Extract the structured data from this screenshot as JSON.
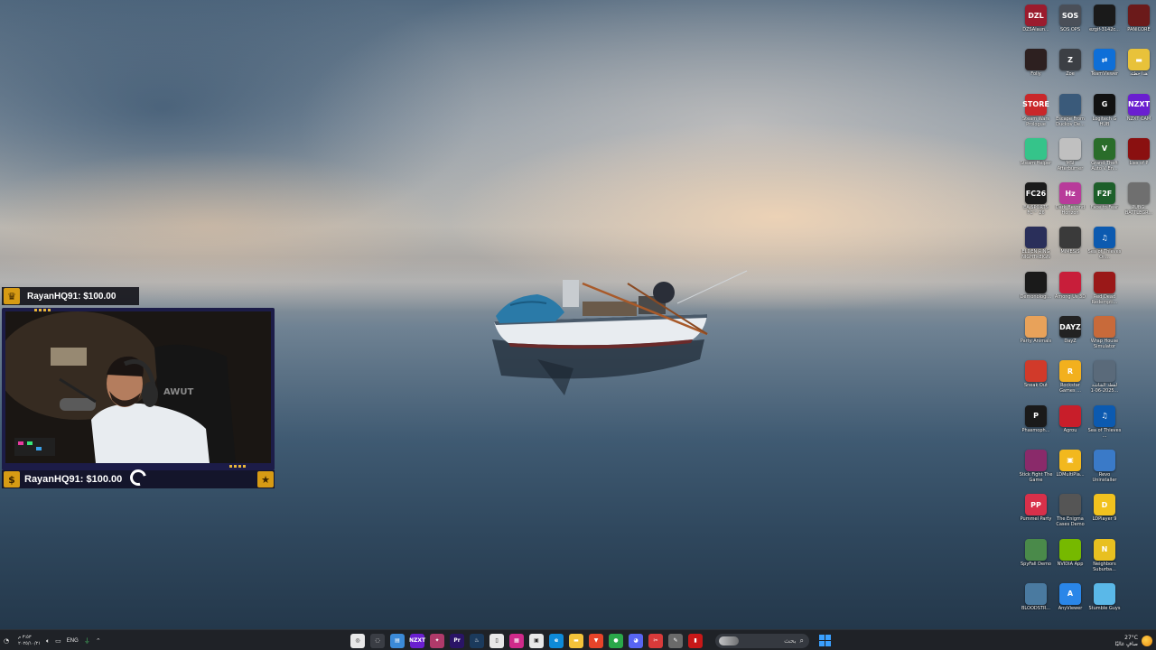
{
  "overlay": {
    "top_alert": "RayanHQ91: $100.00",
    "bottom_alert": "RayanHQ91: $100.00",
    "chair_brand": "AWUT"
  },
  "desktop_icons": [
    {
      "label": "DZSAlaun...",
      "tile": "DZL",
      "color": "#9b1c2e"
    },
    {
      "label": "SOS OPS",
      "tile": "SOS",
      "color": "#4a4f58"
    },
    {
      "label": "ezgif-3142c...",
      "tile": "",
      "color": "#1a1a1a"
    },
    {
      "label": "PANICORE",
      "tile": "",
      "color": "#6b1a1a"
    },
    {
      "label": "Folly",
      "tile": "",
      "color": "#2d2020"
    },
    {
      "label": "Zoe",
      "tile": "Z",
      "color": "#3c3f44"
    },
    {
      "label": "TeamViewer",
      "tile": "⇄",
      "color": "#0e6fd8"
    },
    {
      "label": "هذا خطئه",
      "tile": "▬",
      "color": "#e8c23a"
    },
    {
      "label": "Steam Wars Prologue",
      "tile": "STORE",
      "color": "#c9272a"
    },
    {
      "label": "Escape From Duckov De...",
      "tile": "",
      "color": "#3a5a7a"
    },
    {
      "label": "Logitech G HUB",
      "tile": "G",
      "color": "#111111"
    },
    {
      "label": "NZXT CAM",
      "tile": "NZXT",
      "color": "#6a1fd0"
    },
    {
      "label": "Steam Helper",
      "tile": "",
      "color": "#35c48a"
    },
    {
      "label": "MSI Afterburner",
      "tile": "",
      "color": "#c0c0c0"
    },
    {
      "label": "Grand Theft Auto V En...",
      "tile": "V",
      "color": "#2a6d2a"
    },
    {
      "label": "Lies of P",
      "tile": "",
      "color": "#8a1010"
    },
    {
      "label": "EA SPORTS FC™ 26",
      "tile": "FC26",
      "color": "#1b1b1b"
    },
    {
      "label": "Dark Beyond Horizon",
      "tile": "Hz",
      "color": "#b83b9a"
    },
    {
      "label": "Face to Fear",
      "tile": "F2F",
      "color": "#1d5f2a"
    },
    {
      "label": "PUBG: BATTLEGR...",
      "tile": "",
      "color": "#6f6f6f"
    },
    {
      "label": "ELDEN RING NIGHTREIGN",
      "tile": "",
      "color": "#2a2f5a"
    },
    {
      "label": "MIMESIS",
      "tile": "",
      "color": "#3a3a3a"
    },
    {
      "label": "Sea of Thieves On...",
      "tile": "♫",
      "color": "#0c5ab0"
    },
    {
      "label": "",
      "tile": "",
      "color": "transparent"
    },
    {
      "label": "Demonologi...",
      "tile": "",
      "color": "#1a1a1a"
    },
    {
      "label": "Among Us 3D",
      "tile": "",
      "color": "#c81e3a"
    },
    {
      "label": "Red Dead Redempti...",
      "tile": "",
      "color": "#9a1818"
    },
    {
      "label": "",
      "tile": "",
      "color": "transparent"
    },
    {
      "label": "Party Animals",
      "tile": "",
      "color": "#e8a25a"
    },
    {
      "label": "DayZ",
      "tile": "DAYZ",
      "color": "#222222"
    },
    {
      "label": "Wrap House Simulator",
      "tile": "",
      "color": "#c86a3a"
    },
    {
      "label": "",
      "tile": "",
      "color": "transparent"
    },
    {
      "label": "Sneak Out",
      "tile": "",
      "color": "#d13a2a"
    },
    {
      "label": "Rockstar Games ...",
      "tile": "R",
      "color": "#f2b01e"
    },
    {
      "label": "لقطة الشاشة 2025-06-1...",
      "tile": "",
      "color": "#5a6a7a"
    },
    {
      "label": "",
      "tile": "",
      "color": "transparent"
    },
    {
      "label": "Phasmoph...",
      "tile": "P",
      "color": "#1a1a1a"
    },
    {
      "label": "Agrou",
      "tile": "",
      "color": "#c81e2a"
    },
    {
      "label": "Sea of Thieves ...",
      "tile": "♫",
      "color": "#0c5ab0"
    },
    {
      "label": "",
      "tile": "",
      "color": "transparent"
    },
    {
      "label": "Stick Fight The Game",
      "tile": "",
      "color": "#8a2a6a"
    },
    {
      "label": "LDMultiPla...",
      "tile": "▣",
      "color": "#f2b81e"
    },
    {
      "label": "Revo Uninstaller",
      "tile": "",
      "color": "#3a7ac8"
    },
    {
      "label": "",
      "tile": "",
      "color": "transparent"
    },
    {
      "label": "Pummel Party",
      "tile": "PP",
      "color": "#d8304a"
    },
    {
      "label": "The Enigma Cases Demo",
      "tile": "",
      "color": "#555555"
    },
    {
      "label": "LDPlayer 9",
      "tile": "D",
      "color": "#f2c21e"
    },
    {
      "label": "",
      "tile": "",
      "color": "transparent"
    },
    {
      "label": "SpyFall Demo",
      "tile": "",
      "color": "#4a8a4a"
    },
    {
      "label": "NVIDIA App",
      "tile": "",
      "color": "#76b900"
    },
    {
      "label": "Neighbors Suburba...",
      "tile": "N",
      "color": "#e8c020"
    },
    {
      "label": "",
      "tile": "",
      "color": "transparent"
    },
    {
      "label": "BLOODSTR...",
      "tile": "",
      "color": "#4a7aa0"
    },
    {
      "label": "AnyViewer",
      "tile": "A",
      "color": "#2a86e8"
    },
    {
      "label": "Stumble Guys",
      "tile": "",
      "color": "#5ab8e8"
    }
  ],
  "taskbar": {
    "time": "٣:٥٣ م",
    "date": "٢٠٢٥/١٠/٢١",
    "language": "ENG",
    "search_placeholder": "بحث",
    "weather_temp": "27°C",
    "weather_desc": "صافٍ غالبًا",
    "pins": [
      {
        "name": "screenshot-app",
        "color": "#e8e8e8",
        "label": "◎"
      },
      {
        "name": "task-view",
        "color": "#3a3d44",
        "label": "◌"
      },
      {
        "name": "notepad",
        "color": "#3b8ad8",
        "label": "▤"
      },
      {
        "name": "nzxt",
        "color": "#6a1fd0",
        "label": "NZXT"
      },
      {
        "name": "app-pink",
        "color": "#b03a6a",
        "label": "✦"
      },
      {
        "name": "premiere",
        "color": "#2a1466",
        "label": "Pr"
      },
      {
        "name": "steam",
        "color": "#1b3a5c",
        "label": "♨"
      },
      {
        "name": "file",
        "color": "#e8e8e8",
        "label": "▯"
      },
      {
        "name": "app-magenta",
        "color": "#d02a8a",
        "label": "▦"
      },
      {
        "name": "store",
        "color": "#e8e8e8",
        "label": "▣"
      },
      {
        "name": "edge",
        "color": "#0e8ad8",
        "label": "e"
      },
      {
        "name": "explorer",
        "color": "#f2c23a",
        "label": "▬"
      },
      {
        "name": "brave",
        "color": "#e8442a",
        "label": "▼"
      },
      {
        "name": "chrome",
        "color": "#2aa84a",
        "label": "●"
      },
      {
        "name": "discord",
        "color": "#5865f2",
        "label": "◕"
      },
      {
        "name": "snip",
        "color": "#d83a3a",
        "label": "✂"
      },
      {
        "name": "tool",
        "color": "#6a6a6a",
        "label": "✎"
      },
      {
        "name": "red-app",
        "color": "#c81818",
        "label": "▮"
      }
    ]
  }
}
